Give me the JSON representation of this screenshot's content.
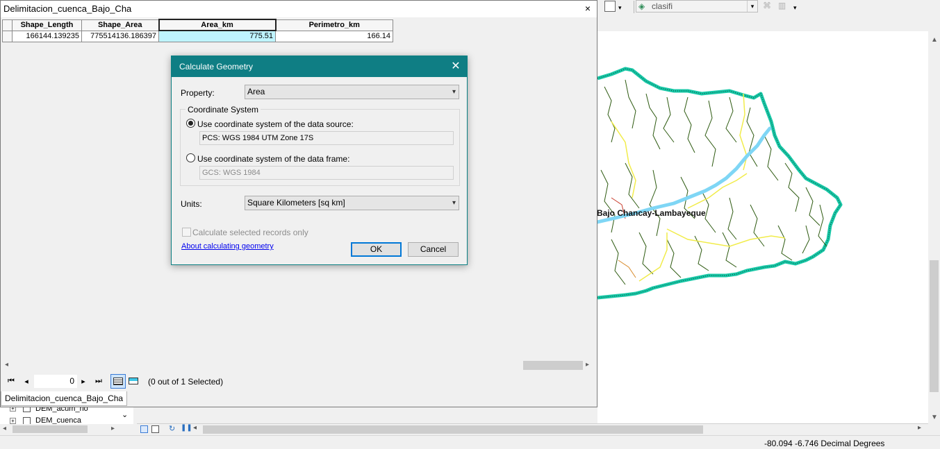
{
  "table": {
    "title": "Delimitacion_cuenca_Bajo_Cha",
    "close_glyph": "×",
    "columns": [
      "Shape_Length",
      "Shape_Area",
      "Area_km",
      "Perimetro_km"
    ],
    "rows": [
      [
        "166144.139235",
        "775514136.186397",
        "775.51",
        "166.14"
      ]
    ],
    "record_number": "0",
    "selection_status": "(0 out of 1 Selected)",
    "tab_label": "Delimitacion_cuenca_Bajo_Cha"
  },
  "dialog": {
    "title": "Calculate Geometry",
    "property_label": "Property:",
    "property_value": "Area",
    "coord_group_label": "Coordinate System",
    "option_source_label": "Use coordinate system of the data source:",
    "option_source_value": "PCS: WGS 1984 UTM Zone 17S",
    "option_frame_label": "Use coordinate system of the data frame:",
    "option_frame_value": "GCS: WGS 1984",
    "units_label": "Units:",
    "units_value": "Square Kilometers [sq km]",
    "selected_only_label": "Calculate selected records only",
    "help_link": "About calculating geometry",
    "ok_label": "OK",
    "cancel_label": "Cancel"
  },
  "toolbar": {
    "layer_combo": "clasifi"
  },
  "map": {
    "label": "Bajo Chancay-Lambayeque",
    "colors": {
      "boundary": "#17c7a6",
      "river_main": "#7fd6f5",
      "river_yellow": "#f1ec4a",
      "stream": "#2d5a10"
    }
  },
  "toc": {
    "items": [
      "DEM_acum_rio",
      "DEM_cuenca"
    ]
  },
  "status": {
    "coords": "-80.094  -6.746 Decimal Degrees"
  }
}
